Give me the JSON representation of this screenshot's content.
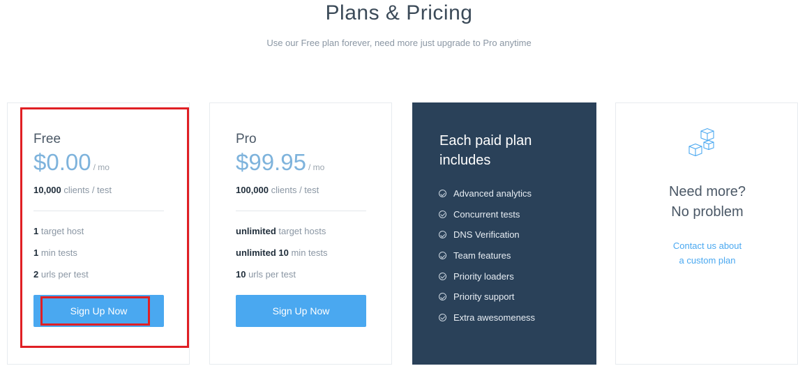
{
  "header": {
    "title": "Plans & Pricing",
    "subtitle": "Use our Free plan forever, need more just upgrade to Pro anytime"
  },
  "plans": [
    {
      "name": "Free",
      "price": "$0.00",
      "per": "/ mo",
      "clients_bold": "10,000",
      "clients_rest": " clients / test",
      "lines": [
        {
          "bold": "1",
          "rest": " target host"
        },
        {
          "bold": "1",
          "rest": " min tests"
        },
        {
          "bold": "2",
          "rest": " urls per test"
        }
      ],
      "button": "Sign Up Now"
    },
    {
      "name": "Pro",
      "price": "$99.95",
      "per": "/ mo",
      "clients_bold": "100,000",
      "clients_rest": " clients / test",
      "lines": [
        {
          "bold": "unlimited",
          "rest": " target hosts"
        },
        {
          "bold": "unlimited 10",
          "rest": " min tests"
        },
        {
          "bold": "10",
          "rest": " urls per test"
        }
      ],
      "button": "Sign Up Now"
    }
  ],
  "features": {
    "title": "Each paid plan includes",
    "items": [
      "Advanced analytics",
      "Concurrent tests",
      "DNS Verification",
      "Team features",
      "Priority loaders",
      "Priority support",
      "Extra awesomeness"
    ],
    "icon": "check-circle-icon"
  },
  "more": {
    "icon": "cubes-icon",
    "title_line1": "Need more?",
    "title_line2": "No problem",
    "link_line1": "Contact us about",
    "link_line2": "a custom plan"
  },
  "colors": {
    "accent": "#4aa8f0",
    "price": "#7eb3dc",
    "feature_bg": "#2a4159",
    "highlight": "#e01f24"
  }
}
